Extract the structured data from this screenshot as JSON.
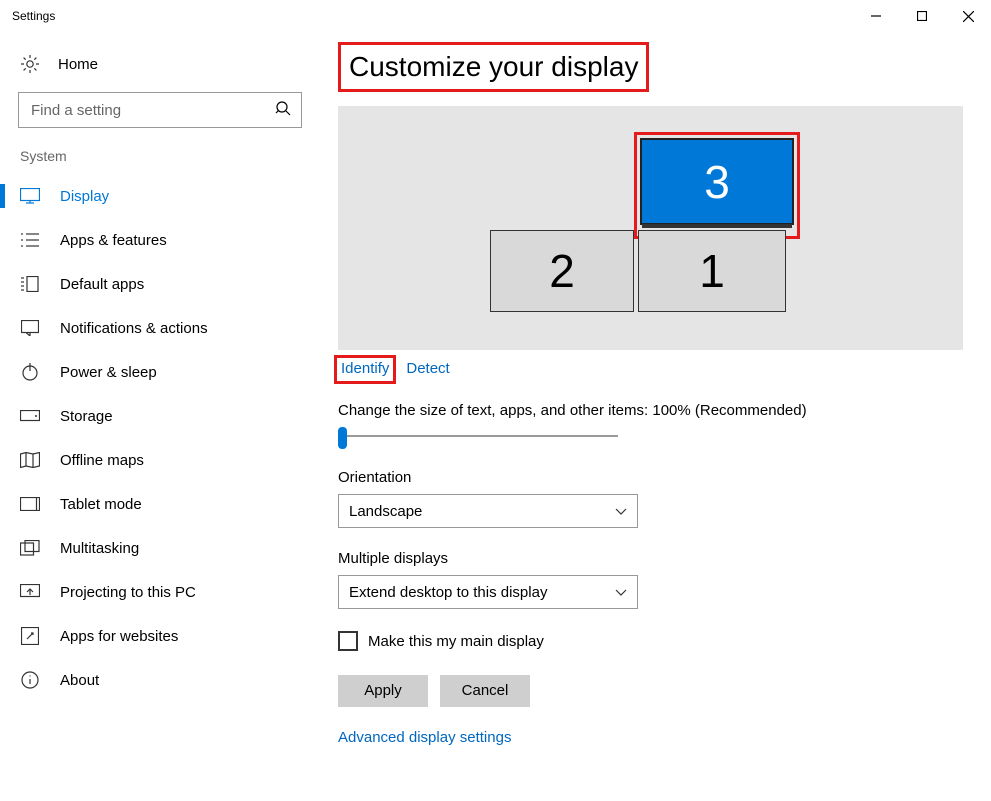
{
  "window": {
    "title": "Settings"
  },
  "sidebar": {
    "home_label": "Home",
    "search_placeholder": "Find a setting",
    "section_label": "System",
    "items": [
      {
        "label": "Display",
        "active": true
      },
      {
        "label": "Apps & features"
      },
      {
        "label": "Default apps"
      },
      {
        "label": "Notifications & actions"
      },
      {
        "label": "Power & sleep"
      },
      {
        "label": "Storage"
      },
      {
        "label": "Offline maps"
      },
      {
        "label": "Tablet mode"
      },
      {
        "label": "Multitasking"
      },
      {
        "label": "Projecting to this PC"
      },
      {
        "label": "Apps for websites"
      },
      {
        "label": "About"
      }
    ]
  },
  "main": {
    "page_title": "Customize your display",
    "monitors": {
      "m1": "1",
      "m2": "2",
      "m3": "3",
      "selected": "3"
    },
    "identify_label": "Identify",
    "detect_label": "Detect",
    "scale_label": "Change the size of text, apps, and other items: 100% (Recommended)",
    "orientation_label": "Orientation",
    "orientation_value": "Landscape",
    "multiple_label": "Multiple displays",
    "multiple_value": "Extend desktop to this display",
    "main_display_label": "Make this my main display",
    "apply_label": "Apply",
    "cancel_label": "Cancel",
    "advanced_label": "Advanced display settings"
  }
}
